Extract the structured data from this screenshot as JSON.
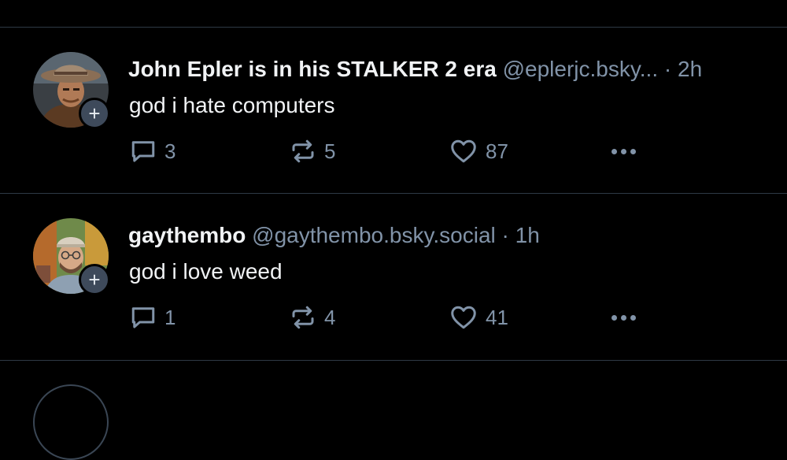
{
  "posts": [
    {
      "author_name": "John Epler is in his STALKER 2 era",
      "handle": "@eplerjc.bsky...",
      "separator": "·",
      "time": "2h",
      "text": "god i hate computers",
      "reply_count": "3",
      "repost_count": "5",
      "like_count": "87",
      "follow_symbol": "+"
    },
    {
      "author_name": "gaythembo",
      "handle": "@gaythembo.bsky.social",
      "separator": "·",
      "time": "1h",
      "text": "god i love weed",
      "reply_count": "1",
      "repost_count": "4",
      "like_count": "41",
      "follow_symbol": "+"
    }
  ],
  "icons": {
    "reply": "speech-bubble-icon",
    "repost": "repost-arrows-icon",
    "like": "heart-icon",
    "more": "ellipsis-icon",
    "follow": "plus-icon"
  },
  "colors": {
    "background": "#000000",
    "divider": "#2e3945",
    "primary_text": "#f1f3f5",
    "secondary_text": "#8193a8",
    "follow_badge": "#3e4a5b"
  }
}
